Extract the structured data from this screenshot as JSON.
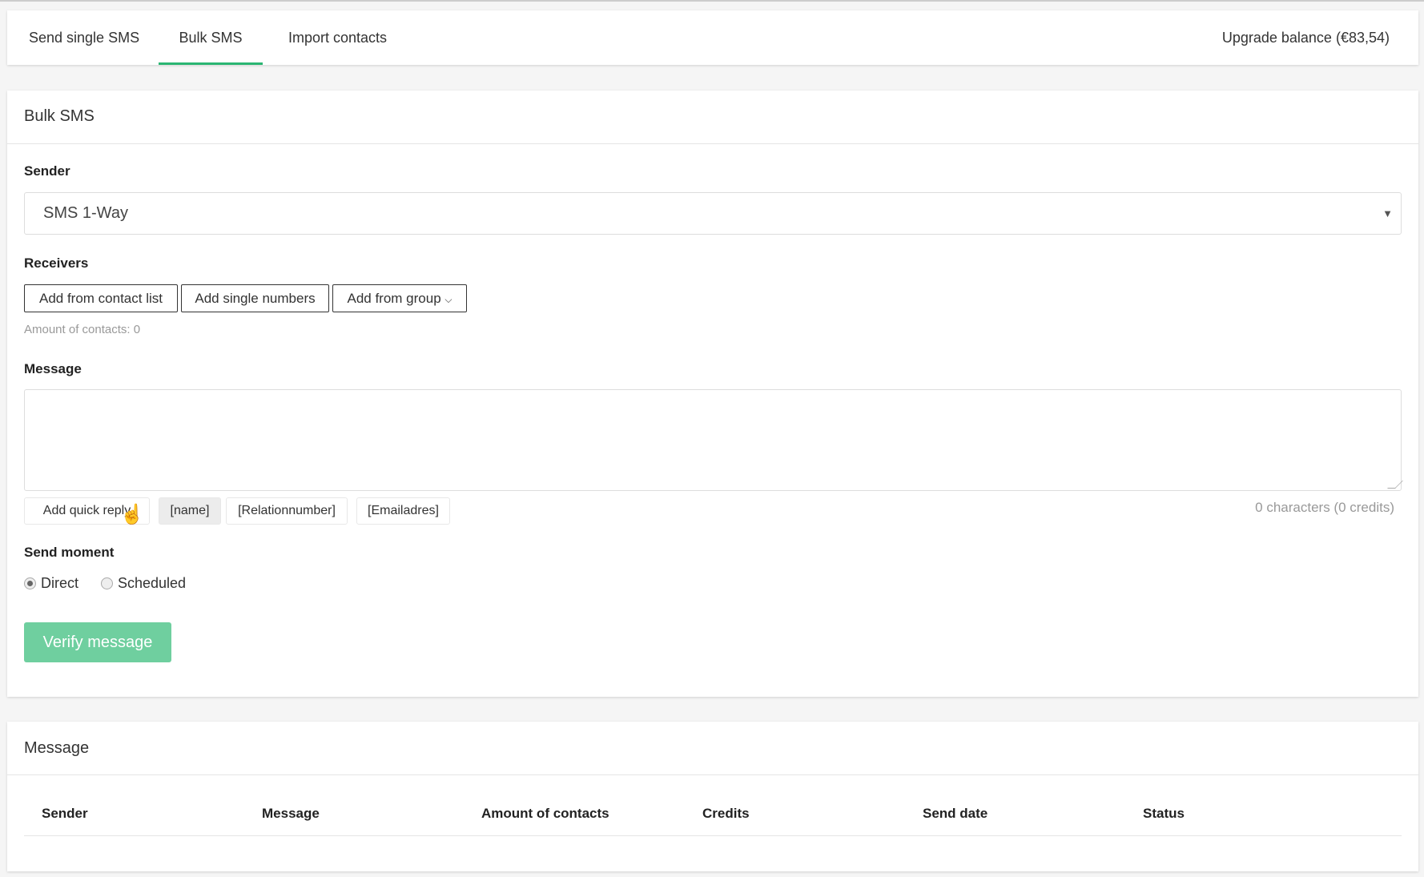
{
  "tabs": [
    {
      "label": "Send single SMS"
    },
    {
      "label": "Bulk SMS"
    },
    {
      "label": "Import contacts"
    }
  ],
  "upgrade": "Upgrade balance (€83,54)",
  "form": {
    "title": "Bulk SMS",
    "sender_label": "Sender",
    "sender_value": "SMS 1-Way",
    "receivers_label": "Receivers",
    "buttons": {
      "contact_list": "Add from contact list",
      "single_numbers": "Add single numbers",
      "from_group": "Add from group"
    },
    "amount": "Amount of contacts: 0",
    "message_label": "Message",
    "message_value": "",
    "quick_reply": "Add quick reply",
    "placeholders": [
      "[name]",
      "[Relationnumber]",
      "[Emailadres]"
    ],
    "chars": "0 characters (0 credits)",
    "send_moment_label": "Send moment",
    "radio_direct": "Direct",
    "radio_scheduled": "Scheduled",
    "verify": "Verify message"
  },
  "list": {
    "title": "Message",
    "columns": [
      "Sender",
      "Message",
      "Amount of contacts",
      "Credits",
      "Send date",
      "Status"
    ]
  },
  "colors": {
    "accent": "#2bb673",
    "verify": "#6fcf9f"
  }
}
